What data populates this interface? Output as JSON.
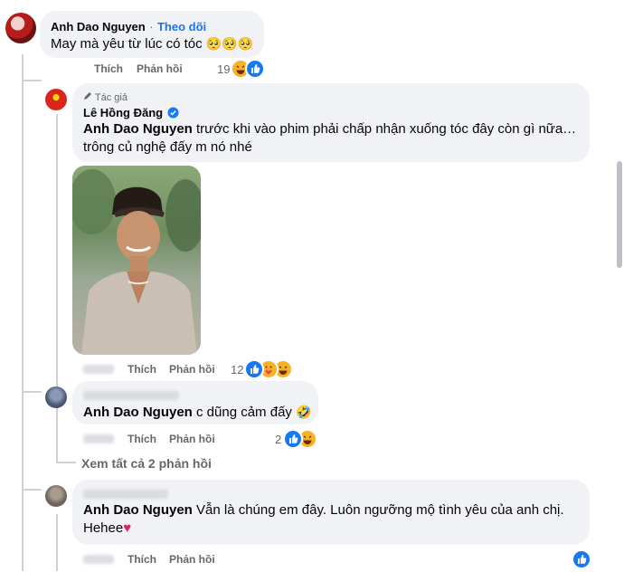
{
  "comment1": {
    "author": "Anh Dao Nguyen",
    "follow": "Theo dõi",
    "separator": "·",
    "text": "May mà yêu từ lúc có tóc",
    "emoji": "🥺🥺🥺",
    "like": "Thích",
    "reply": "Phản hồi",
    "reaction_count": "19"
  },
  "reply1": {
    "author_badge": "Tác giả",
    "author": "Lê Hồng Đăng",
    "mention": "Anh Dao Nguyen",
    "text": "trước khi vào phim phải chấp nhận xuống tóc đây còn gì nữa… trông củ nghệ đấy m nó nhé",
    "like": "Thích",
    "reply": "Phản hồi",
    "reaction_count": "12"
  },
  "reply2": {
    "mention": "Anh Dao Nguyen",
    "text": "c dũng cảm đấy",
    "emoji": "🤣",
    "like": "Thích",
    "reply": "Phản hồi",
    "reaction_count": "2"
  },
  "view_all_replies": "Xem tất cả 2 phản hồi",
  "reply3": {
    "mention": "Anh Dao Nguyen",
    "text": "Vẫn là chúng em đây. Luôn ngưỡng mộ tình yêu của anh chị. Hehee",
    "emoji": "♥",
    "like": "Thích",
    "reply": "Phản hồi"
  },
  "colors": {
    "link_blue": "#1877f2",
    "bubble_bg": "#f0f2f5",
    "meta_gray": "#65676b",
    "thread_line": "#ced0d4"
  },
  "icons": [
    "verified-badge-icon",
    "pen-icon",
    "like-reaction-icon",
    "haha-reaction-icon",
    "care-reaction-icon",
    "heart-emoji"
  ]
}
